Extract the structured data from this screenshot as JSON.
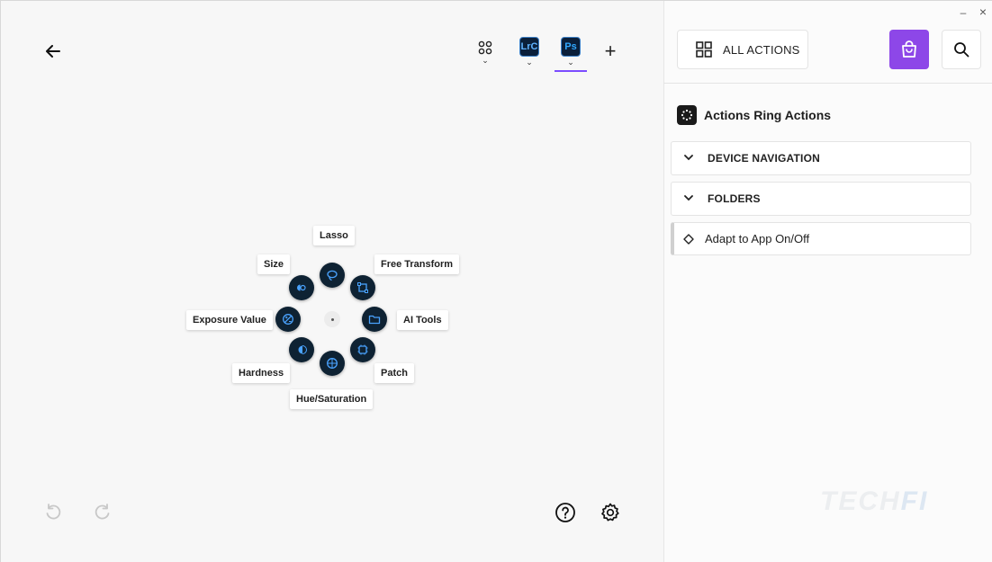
{
  "window_controls": {
    "minimize": "–",
    "close": "×"
  },
  "header": {
    "apps": [
      {
        "name": "all-apps",
        "label": ""
      },
      {
        "name": "lightroom-classic",
        "label": "LrC"
      },
      {
        "name": "photoshop",
        "label": "Ps",
        "active": true
      }
    ],
    "add_label": "+"
  },
  "ring": {
    "labels": {
      "top": "Lasso",
      "top_right": "Free Transform",
      "right": "AI Tools",
      "bottom_right": "Patch",
      "bottom": "Hue/Saturation",
      "bottom_left": "Hardness",
      "left": "Exposure Value",
      "top_left": "Size"
    }
  },
  "right_panel": {
    "all_actions_label": "ALL ACTIONS",
    "section_title": "Actions Ring Actions",
    "accordions": [
      "DEVICE NAVIGATION",
      "FOLDERS"
    ],
    "items": [
      "Adapt to App On/Off"
    ]
  },
  "watermark": {
    "part1": "TECH",
    "part2": "FI"
  },
  "colors": {
    "accent": "#8d47e8",
    "ring_button": "#0e2233",
    "ring_icon": "#4aa3ff",
    "tab_underline": "#7c4dff"
  }
}
